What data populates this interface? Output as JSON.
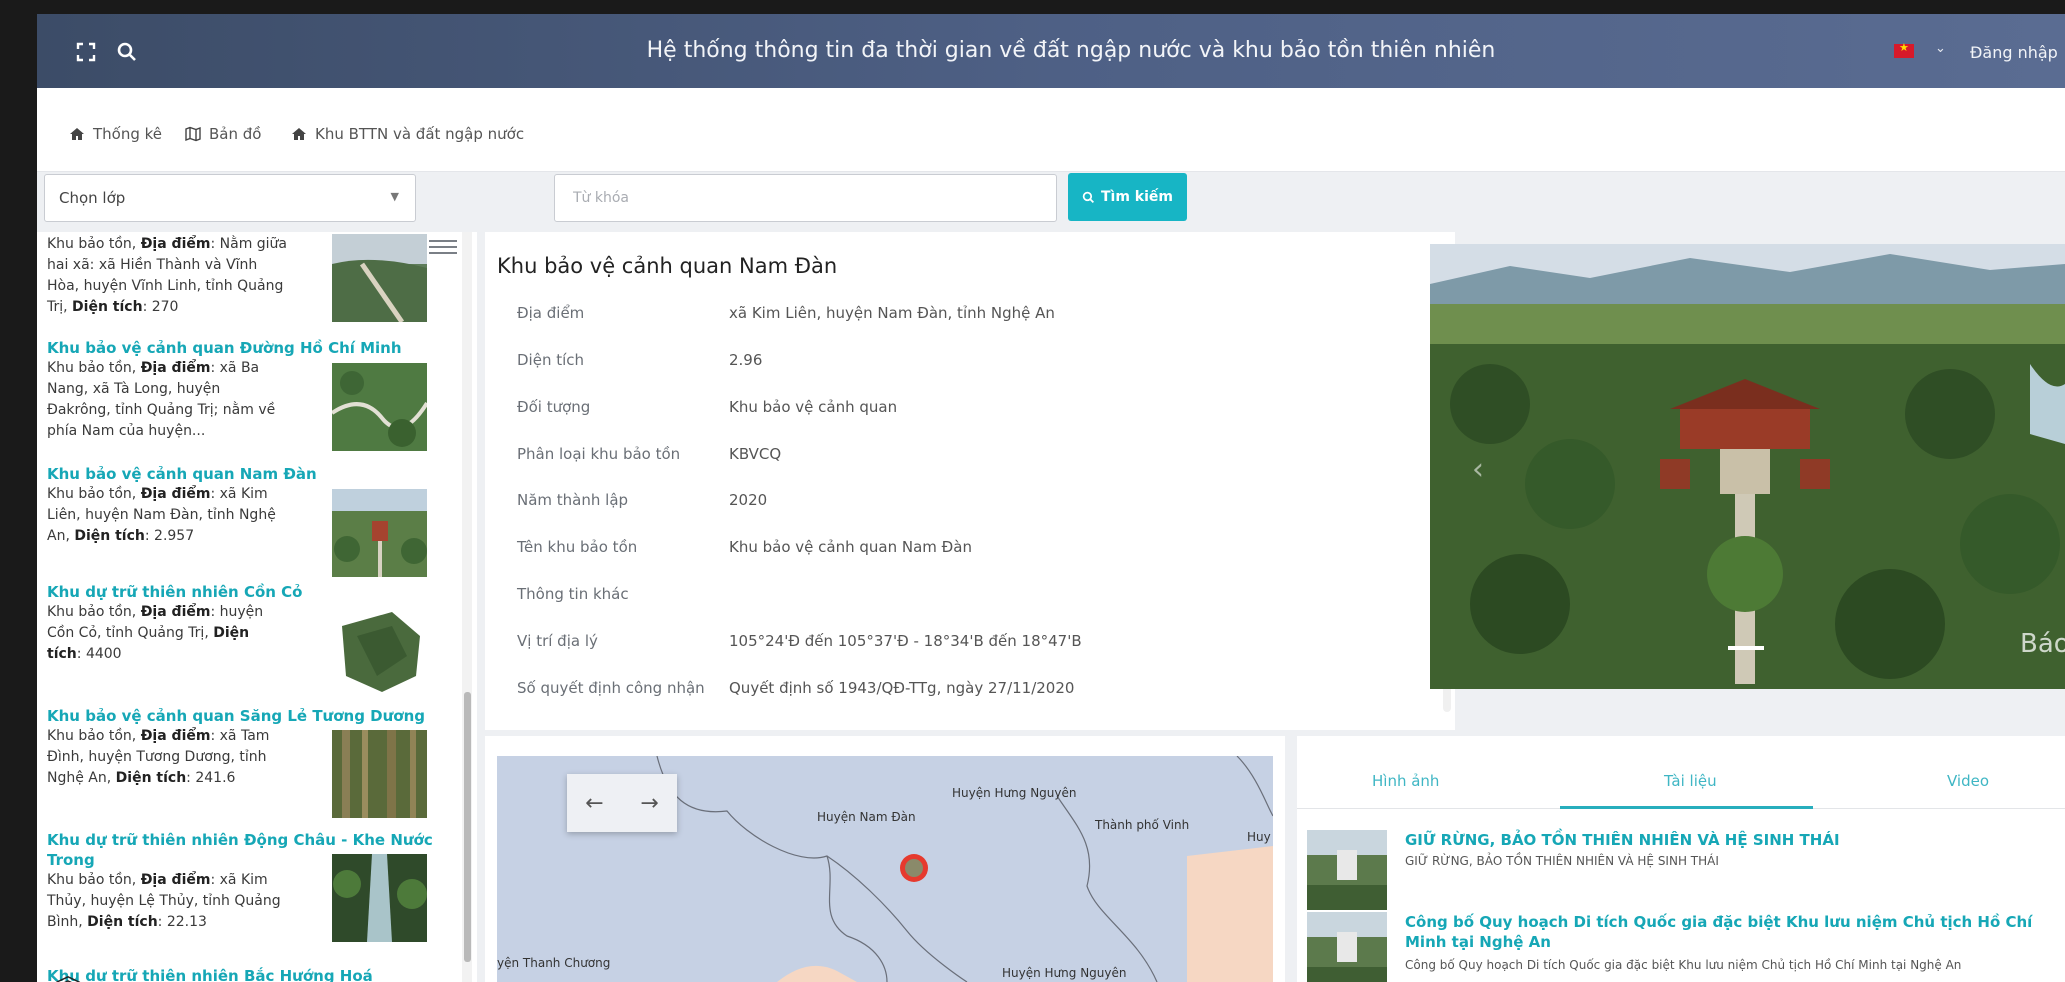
{
  "header": {
    "title": "Hệ thống thông tin đa thời gian về đất ngập nước và khu bảo tồn thiên nhiên",
    "login_label": "Đăng nhập",
    "language_flag": "vn-flag-icon",
    "caret": "⌄"
  },
  "nav": {
    "items": [
      {
        "label": "Thống kê",
        "icon": "home-icon"
      },
      {
        "label": "Bản đồ",
        "icon": "map-icon"
      },
      {
        "label": "Khu BTTN và đất ngập nước",
        "icon": "home-icon"
      }
    ]
  },
  "controls": {
    "layer_select": "Chọn lớp",
    "keyword_placeholder": "Từ khóa",
    "search_label": "Tìm kiếm"
  },
  "list": {
    "items": [
      {
        "name": "",
        "type": "Khu bảo tồn",
        "loc_label": "Địa điểm",
        "loc": "Nằm giữa hai xã: xã Hiền Thành và Vĩnh Hòa, huyện Vĩnh Linh, tỉnh Quảng Trị",
        "area_label": "Diện tích",
        "area": "270"
      },
      {
        "name": "Khu bảo vệ cảnh quan Đường Hồ Chí Minh",
        "type": "Khu bảo tồn",
        "loc_label": "Địa điểm",
        "loc": "xã Ba Nang, xã Tà Long, huyện Đakrông, tỉnh Quảng Trị; nằm về phía Nam của huyện...",
        "area_label": "",
        "area": ""
      },
      {
        "name": "Khu bảo vệ cảnh quan Nam Đàn",
        "type": "Khu bảo tồn",
        "loc_label": "Địa điểm",
        "loc": "xã Kim Liên, huyện Nam Đàn, tỉnh Nghệ An",
        "area_label": "Diện tích",
        "area": "2.957"
      },
      {
        "name": "Khu dự trữ thiên nhiên Cồn Cỏ",
        "type": "Khu bảo tồn",
        "loc_label": "Địa điểm",
        "loc": "huyện Cồn Cỏ, tỉnh Quảng Trị",
        "area_label": "Diện tích",
        "area": "4400"
      },
      {
        "name": "Khu bảo vệ cảnh quan Săng Lẻ Tương Dương",
        "type": "Khu bảo tồn",
        "loc_label": "Địa điểm",
        "loc": "xã Tam Đình, huyện Tương Dương, tỉnh Nghệ An",
        "area_label": "Diện tích",
        "area": "241.6"
      },
      {
        "name": "Khu dự trữ thiên nhiên Động Châu - Khe Nước Trong",
        "type": "Khu bảo tồn",
        "loc_label": "Địa điểm",
        "loc": "xã Kim Thủy, huyện Lệ Thủy, tỉnh Quảng Bình",
        "area_label": "Diện tích",
        "area": "22.13"
      },
      {
        "name": "Khu dự trữ thiên nhiên Bắc Hướng Hoá",
        "type": "",
        "loc_label": "",
        "loc": "",
        "area_label": "",
        "area": ""
      }
    ]
  },
  "details": {
    "title": "Khu bảo vệ cảnh quan Nam Đàn",
    "rows": [
      {
        "label": "Địa điểm",
        "value": "xã Kim Liên, huyện Nam Đàn, tỉnh Nghệ An"
      },
      {
        "label": "Diện tích",
        "value": "2.96"
      },
      {
        "label": "Đối tượng",
        "value": "Khu bảo vệ cảnh quan"
      },
      {
        "label": "Phân loại khu bảo tồn",
        "value": "KBVCQ"
      },
      {
        "label": "Năm thành lập",
        "value": "2020"
      },
      {
        "label": "Tên khu bảo tồn",
        "value": "Khu bảo vệ cảnh quan Nam Đàn"
      },
      {
        "label": "Thông tin khác",
        "value": ""
      },
      {
        "label": "Vị trí địa lý",
        "value": "105°24'Đ đến 105°37'Đ - 18°34'B đến 18°47'B"
      },
      {
        "label": "Số quyết định công nhận",
        "value": "Quyết định số 1943/QĐ-TTg, ngày 27/11/2020"
      }
    ],
    "photo_watermark": "Báo"
  },
  "map": {
    "labels": [
      "Huyện Hưng Nguyên",
      "Huyện Nam Đàn",
      "Thành phố Vinh",
      "Huy",
      "yện Thanh Chương",
      "Huyện Hưng Nguyên"
    ]
  },
  "media": {
    "tabs": [
      "Hình ảnh",
      "Tài liệu",
      "Video"
    ],
    "active_tab": "Tài liệu",
    "items": [
      {
        "title": "GIỮ RỪNG, BẢO TỒN THIÊN NHIÊN VÀ HỆ SINH THÁI",
        "subtitle": "GIỮ RỪNG, BẢO TỒN THIÊN NHIÊN VÀ HỆ SINH THÁI"
      },
      {
        "title": "Công bố Quy hoạch Di tích Quốc gia đặc biệt Khu lưu niệm Chủ tịch Hồ Chí Minh tại Nghệ An",
        "subtitle": "Công bố Quy hoạch Di tích Quốc gia đặc biệt Khu lưu niệm Chủ tịch Hồ Chí Minh tại Nghệ An"
      }
    ]
  },
  "colors": {
    "header": "#4a5b7d",
    "accent": "#17b5c5",
    "link": "#16a7b6"
  }
}
